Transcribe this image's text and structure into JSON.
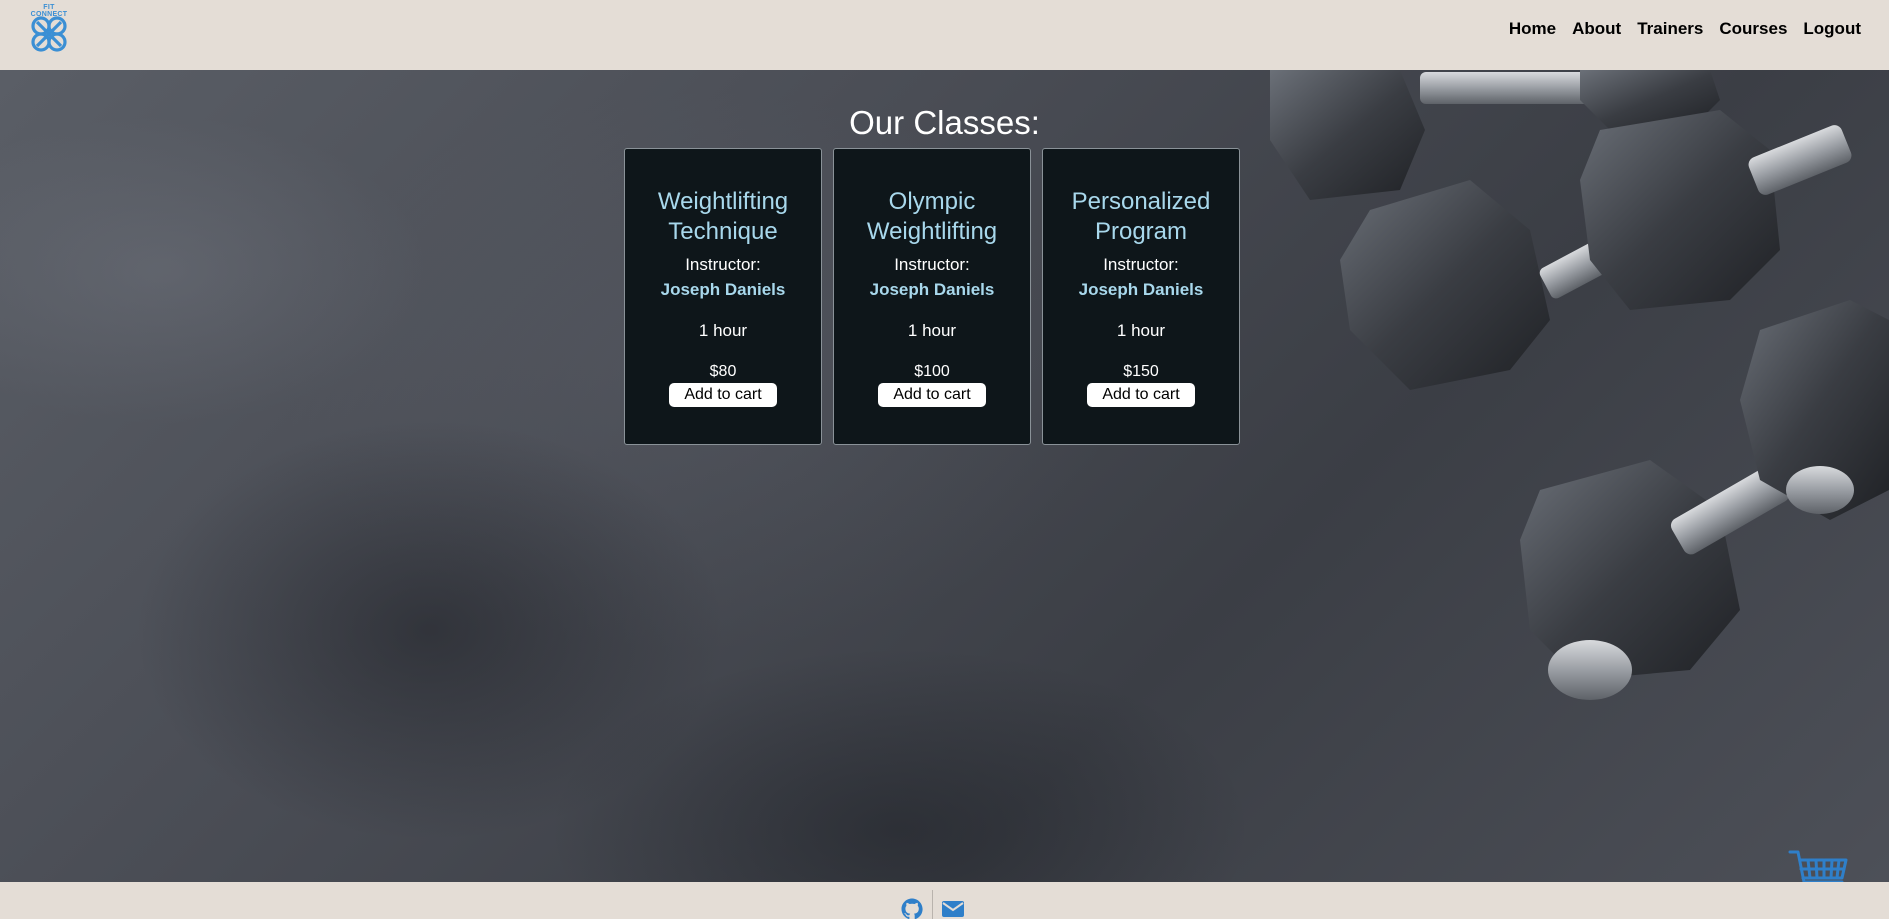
{
  "header": {
    "logo_text": "FIT CONNECT",
    "nav": [
      "Home",
      "About",
      "Trainers",
      "Courses",
      "Logout"
    ]
  },
  "main": {
    "title": "Our Classes:",
    "cards": [
      {
        "title_line1": "Weightlifting",
        "title_line2": "Technique",
        "instructor_label": "Instructor:",
        "instructor": "Joseph Daniels",
        "duration": "1 hour",
        "price": "$80",
        "button": "Add to cart"
      },
      {
        "title_line1": "Olympic",
        "title_line2": "Weightlifting",
        "instructor_label": "Instructor:",
        "instructor": "Joseph Daniels",
        "duration": "1 hour",
        "price": "$100",
        "button": "Add to cart"
      },
      {
        "title_line1": "Personalized",
        "title_line2": "Program",
        "instructor_label": "Instructor:",
        "instructor": "Joseph Daniels",
        "duration": "1 hour",
        "price": "$150",
        "button": "Add to cart"
      }
    ]
  },
  "footer": {
    "icons": [
      "github-icon",
      "mail-icon"
    ]
  },
  "colors": {
    "header_bg": "#e4ddd6",
    "card_bg": "#0e161a",
    "accent": "#a8d8ec",
    "icon_blue": "#2f7fc9"
  }
}
